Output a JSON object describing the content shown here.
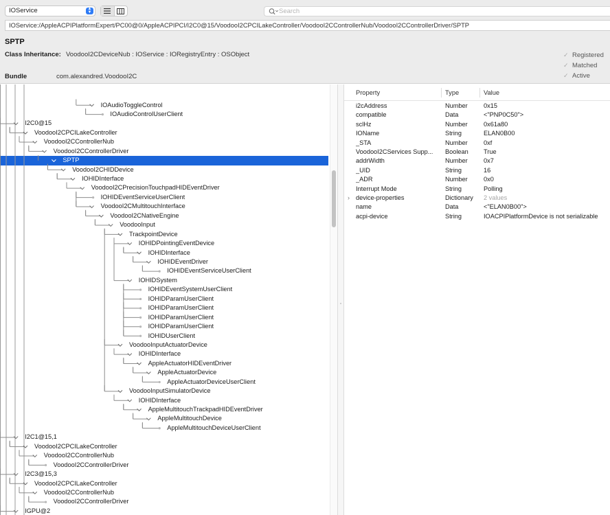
{
  "toolbar": {
    "plane": "IOService",
    "search_placeholder": "Search"
  },
  "path": "IOService:/AppleACPIPlatformExpert/PC00@0/AppleACPIPCI/I2C0@15/VoodooI2CPCILakeController/VoodooI2CControllerNub/VoodooI2CControllerDriver/SPTP",
  "header": {
    "title": "SPTP",
    "class_label": "Class Inheritance:",
    "class_value": "VoodooI2CDeviceNub : IOService : IORegistryEntry : OSObject",
    "bundle_label": "Bundle",
    "bundle_value": "com.alexandred.VoodooI2C",
    "flags": [
      "Registered",
      "Matched",
      "Active"
    ]
  },
  "tree": [
    {
      "d": 12,
      "label": "IOAudioToggleControl",
      "s": "e"
    },
    {
      "d": 13,
      "label": "IOAudioControlUserClient",
      "s": "l"
    },
    {
      "d": 4,
      "label": "I2C0@15",
      "s": "e"
    },
    {
      "d": 5,
      "label": "VoodooI2CPCILakeController",
      "s": "e"
    },
    {
      "d": 6,
      "label": "VoodooI2CControllerNub",
      "s": "e"
    },
    {
      "d": 7,
      "label": "VoodooI2CControllerDriver",
      "s": "e"
    },
    {
      "d": 8,
      "label": "SPTP",
      "s": "e",
      "sel": true
    },
    {
      "d": 9,
      "label": "VoodooI2CHIDDevice",
      "s": "e"
    },
    {
      "d": 10,
      "label": "IOHIDInterface",
      "s": "e"
    },
    {
      "d": 11,
      "label": "VoodooI2CPrecisionTouchpadHIDEventDriver",
      "s": "e"
    },
    {
      "d": 12,
      "label": "IOHIDEventServiceUserClient",
      "s": "l"
    },
    {
      "d": 12,
      "label": "VoodooI2CMultitouchInterface",
      "s": "e"
    },
    {
      "d": 13,
      "label": "VoodooI2CNativeEngine",
      "s": "e"
    },
    {
      "d": 14,
      "label": "VoodooInput",
      "s": "e"
    },
    {
      "d": 15,
      "label": "TrackpointDevice",
      "s": "e"
    },
    {
      "d": 16,
      "label": "IOHIDPointingEventDevice",
      "s": "e"
    },
    {
      "d": 17,
      "label": "IOHIDInterface",
      "s": "e"
    },
    {
      "d": 18,
      "label": "IOHIDEventDriver",
      "s": "e"
    },
    {
      "d": 19,
      "label": "IOHIDEventServiceUserClient",
      "s": "l"
    },
    {
      "d": 16,
      "label": "IOHIDSystem",
      "s": "e"
    },
    {
      "d": 17,
      "label": "IOHIDEventSystemUserClient",
      "s": "l"
    },
    {
      "d": 17,
      "label": "IOHIDParamUserClient",
      "s": "l"
    },
    {
      "d": 17,
      "label": "IOHIDParamUserClient",
      "s": "l"
    },
    {
      "d": 17,
      "label": "IOHIDParamUserClient",
      "s": "l"
    },
    {
      "d": 17,
      "label": "IOHIDParamUserClient",
      "s": "l"
    },
    {
      "d": 17,
      "label": "IOHIDUserClient",
      "s": "l"
    },
    {
      "d": 15,
      "label": "VoodooInputActuatorDevice",
      "s": "e"
    },
    {
      "d": 16,
      "label": "IOHIDInterface",
      "s": "e"
    },
    {
      "d": 17,
      "label": "AppleActuatorHIDEventDriver",
      "s": "e"
    },
    {
      "d": 18,
      "label": "AppleActuatorDevice",
      "s": "e"
    },
    {
      "d": 19,
      "label": "AppleActuatorDeviceUserClient",
      "s": "l"
    },
    {
      "d": 15,
      "label": "VoodooInputSimulatorDevice",
      "s": "e"
    },
    {
      "d": 16,
      "label": "IOHIDInterface",
      "s": "e"
    },
    {
      "d": 17,
      "label": "AppleMultitouchTrackpadHIDEventDriver",
      "s": "e"
    },
    {
      "d": 18,
      "label": "AppleMultitouchDevice",
      "s": "e"
    },
    {
      "d": 19,
      "label": "AppleMultitouchDeviceUserClient",
      "s": "l"
    },
    {
      "d": 4,
      "label": "I2C1@15,1",
      "s": "e"
    },
    {
      "d": 5,
      "label": "VoodooI2CPCILakeController",
      "s": "e"
    },
    {
      "d": 6,
      "label": "VoodooI2CControllerNub",
      "s": "e"
    },
    {
      "d": 7,
      "label": "VoodooI2CControllerDriver",
      "s": "l"
    },
    {
      "d": 4,
      "label": "I2C3@15,3",
      "s": "e"
    },
    {
      "d": 5,
      "label": "VoodooI2CPCILakeController",
      "s": "e"
    },
    {
      "d": 6,
      "label": "VoodooI2CControllerNub",
      "s": "e"
    },
    {
      "d": 7,
      "label": "VoodooI2CControllerDriver",
      "s": "l"
    },
    {
      "d": 4,
      "label": "IGPU@2",
      "s": "e"
    }
  ],
  "properties": {
    "columns": [
      "Property",
      "Type",
      "Value"
    ],
    "rows": [
      {
        "prop": "i2cAddress",
        "type": "Number",
        "value": "0x15"
      },
      {
        "prop": "compatible",
        "type": "Data",
        "value": "<\"PNP0C50\">"
      },
      {
        "prop": "sclHz",
        "type": "Number",
        "value": "0x61a80"
      },
      {
        "prop": "IOName",
        "type": "String",
        "value": "ELAN0B00"
      },
      {
        "prop": "_STA",
        "type": "Number",
        "value": "0xf"
      },
      {
        "prop": "VoodooI2CServices Supp...",
        "type": "Boolean",
        "value": "True"
      },
      {
        "prop": "addrWidth",
        "type": "Number",
        "value": "0x7"
      },
      {
        "prop": "_UID",
        "type": "String",
        "value": "16"
      },
      {
        "prop": "_ADR",
        "type": "Number",
        "value": "0x0"
      },
      {
        "prop": "Interrupt Mode",
        "type": "String",
        "value": "Polling"
      },
      {
        "prop": "device-properties",
        "type": "Dictionary",
        "value": "2 values",
        "expandable": true,
        "muted": true
      },
      {
        "prop": "name",
        "type": "Data",
        "value": "<\"ELAN0B00\">"
      },
      {
        "prop": "acpi-device",
        "type": "String",
        "value": "IOACPIPlatformDevice is not serializable"
      }
    ]
  },
  "colors": {
    "selection": "#1a64d9",
    "tree_line": "#8c8c8c",
    "toolbar_bg": "#ececec"
  }
}
